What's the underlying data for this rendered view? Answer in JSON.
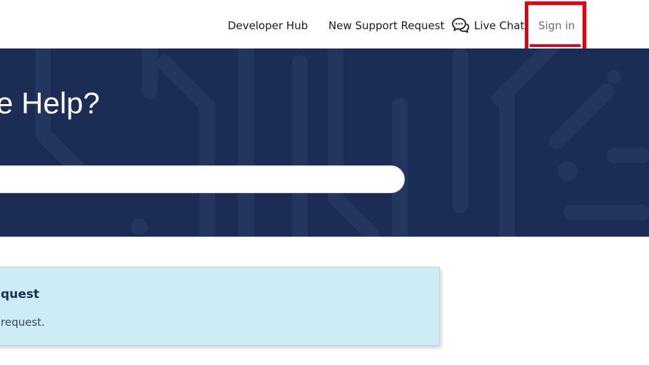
{
  "nav": {
    "developer_hub": "Developer Hub",
    "new_support_request": "New Support Request",
    "live_chat": "Live Chat",
    "sign_in": "Sign in",
    "chat_icon": "chat-bubbles-icon"
  },
  "hero": {
    "title": "e Help?",
    "search_placeholder": ""
  },
  "card": {
    "title": "quest",
    "text": "request."
  },
  "colors": {
    "hero_bg": "#1b2d55",
    "card_bg": "#cdecf5",
    "highlight": "#e8000f",
    "signin_underline": "#c8102e"
  }
}
